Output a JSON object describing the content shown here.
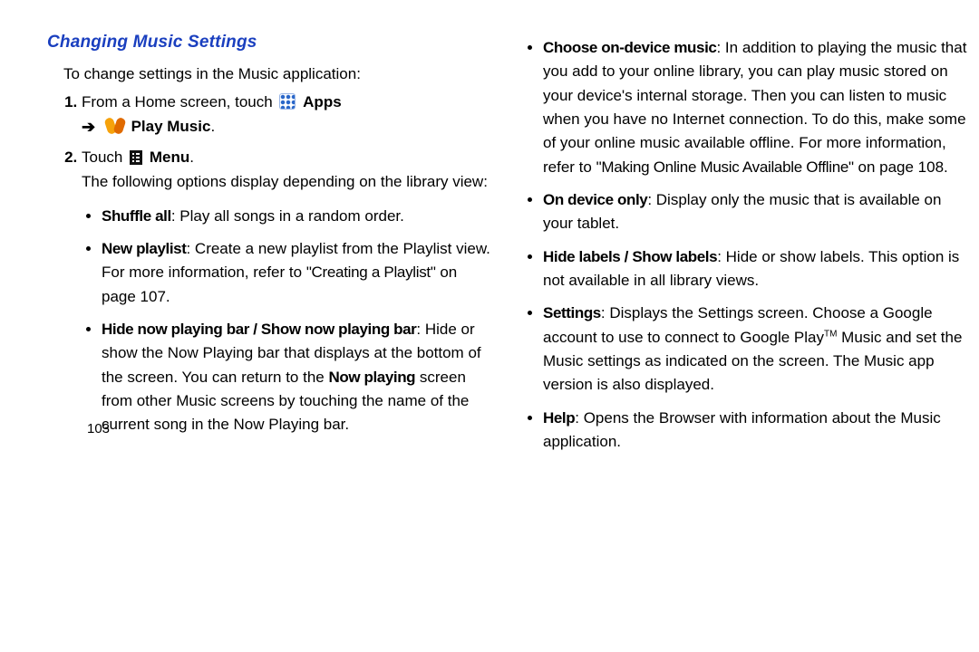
{
  "heading": "Changing Music Settings",
  "intro": "To change settings in the Music application:",
  "step1": {
    "pre": "From a Home screen, touch ",
    "apps": "Apps",
    "playmusic": "Play Music",
    "dot": "."
  },
  "step2": {
    "pre": "Touch ",
    "menu": "Menu",
    "dot": ".",
    "tail": "The following options display depending on the library view:"
  },
  "left_bullets": {
    "shuffle": {
      "lead": "Shuffle all",
      "rest": ": Play all songs in a random order."
    },
    "newplaylist": {
      "lead": "New playlist",
      "rest1": ": Create a new playlist from the Playlist view. For more information, refer to",
      "ref": "\"Creating a Playlist\"",
      "rest2": " on page 107."
    },
    "hidebar": {
      "lead": "Hide now playing bar / Show now playing bar",
      "rest1": ": Hide or show the Now Playing bar that displays at the bottom of the screen. You can return to the ",
      "nowplaying": "Now playing",
      "rest2": " screen from other Music screens by touching the name of the current song in the Now Playing bar."
    }
  },
  "right_bullets": {
    "choose": {
      "lead": "Choose on-device music",
      "rest1": ": In addition to playing the music that you add to your online library, you can play music stored on your device's internal storage. Then you can listen to music when you have no Internet connection. To do this, make some of your online music available offline. For more information, refer to ",
      "ref": "\"Making Online Music Available Offline\"",
      "rest2": " on page 108."
    },
    "ondevice": {
      "lead": "On device only",
      "rest": ": Display only the music that is available on your tablet."
    },
    "labels": {
      "lead": "Hide labels / Show labels",
      "rest": ": Hide or show labels. This option is not available in all library views."
    },
    "settings": {
      "lead": "Settings",
      "rest1": ": Displays the Settings screen. Choose a Google account to use to connect to Google Play",
      "tm": "TM",
      "rest2": " Music and set the Music settings as indicated on the screen. The Music app version is also displayed."
    },
    "help": {
      "lead": "Help",
      "rest": ": Opens the Browser with information about the Music application."
    }
  },
  "pagenum": "103"
}
